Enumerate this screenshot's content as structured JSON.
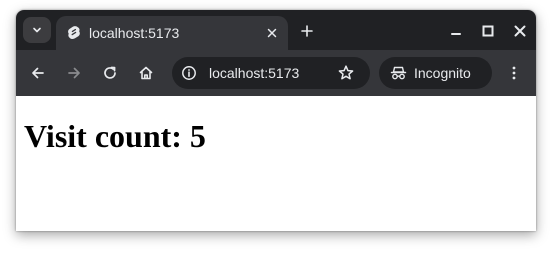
{
  "browser": {
    "tab": {
      "title": "localhost:5173"
    },
    "address_bar": {
      "url": "localhost:5173"
    },
    "profile": {
      "label": "Incognito"
    }
  },
  "page": {
    "heading": "Visit count: 5"
  },
  "icons": {
    "tab_search": "chevron-down-icon",
    "favicon": "svelte-favicon-icon",
    "tab_close": "close-icon",
    "new_tab": "plus-icon",
    "minimize": "minimize-icon",
    "maximize": "maximize-icon",
    "close_window": "close-icon",
    "back": "arrow-left-icon",
    "forward": "arrow-right-icon",
    "reload": "reload-icon",
    "home": "home-icon",
    "site_info": "info-icon",
    "bookmark": "star-icon",
    "incognito": "incognito-icon",
    "menu": "kebab-menu-icon"
  },
  "colors": {
    "titlebar": "#202124",
    "toolbar": "#35363a",
    "omnibox": "#202124",
    "text_light": "#e8eaed",
    "page_background": "#ffffff",
    "heading_text": "#000000"
  }
}
